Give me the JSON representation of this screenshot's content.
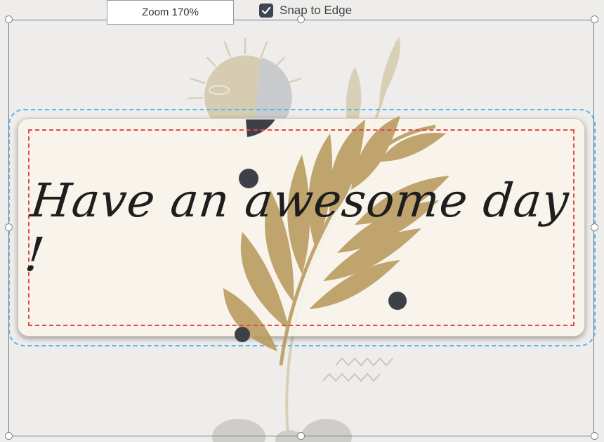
{
  "toolbar": {
    "zoom_label": "Zoom 170%",
    "snap_label": "Snap to Edge",
    "snap_checked": true
  },
  "card": {
    "headline": "Have an awesome day !"
  },
  "colors": {
    "selection_outline": "#55b8f0",
    "safe_area": "#e24a44",
    "leaf": "#b89a5c",
    "sun": "#d3c8ac",
    "dark_dot": "#3d4046"
  },
  "icons": [
    "check-icon",
    "sun-icon",
    "leaf-branch-icon",
    "zigzag-icon"
  ]
}
